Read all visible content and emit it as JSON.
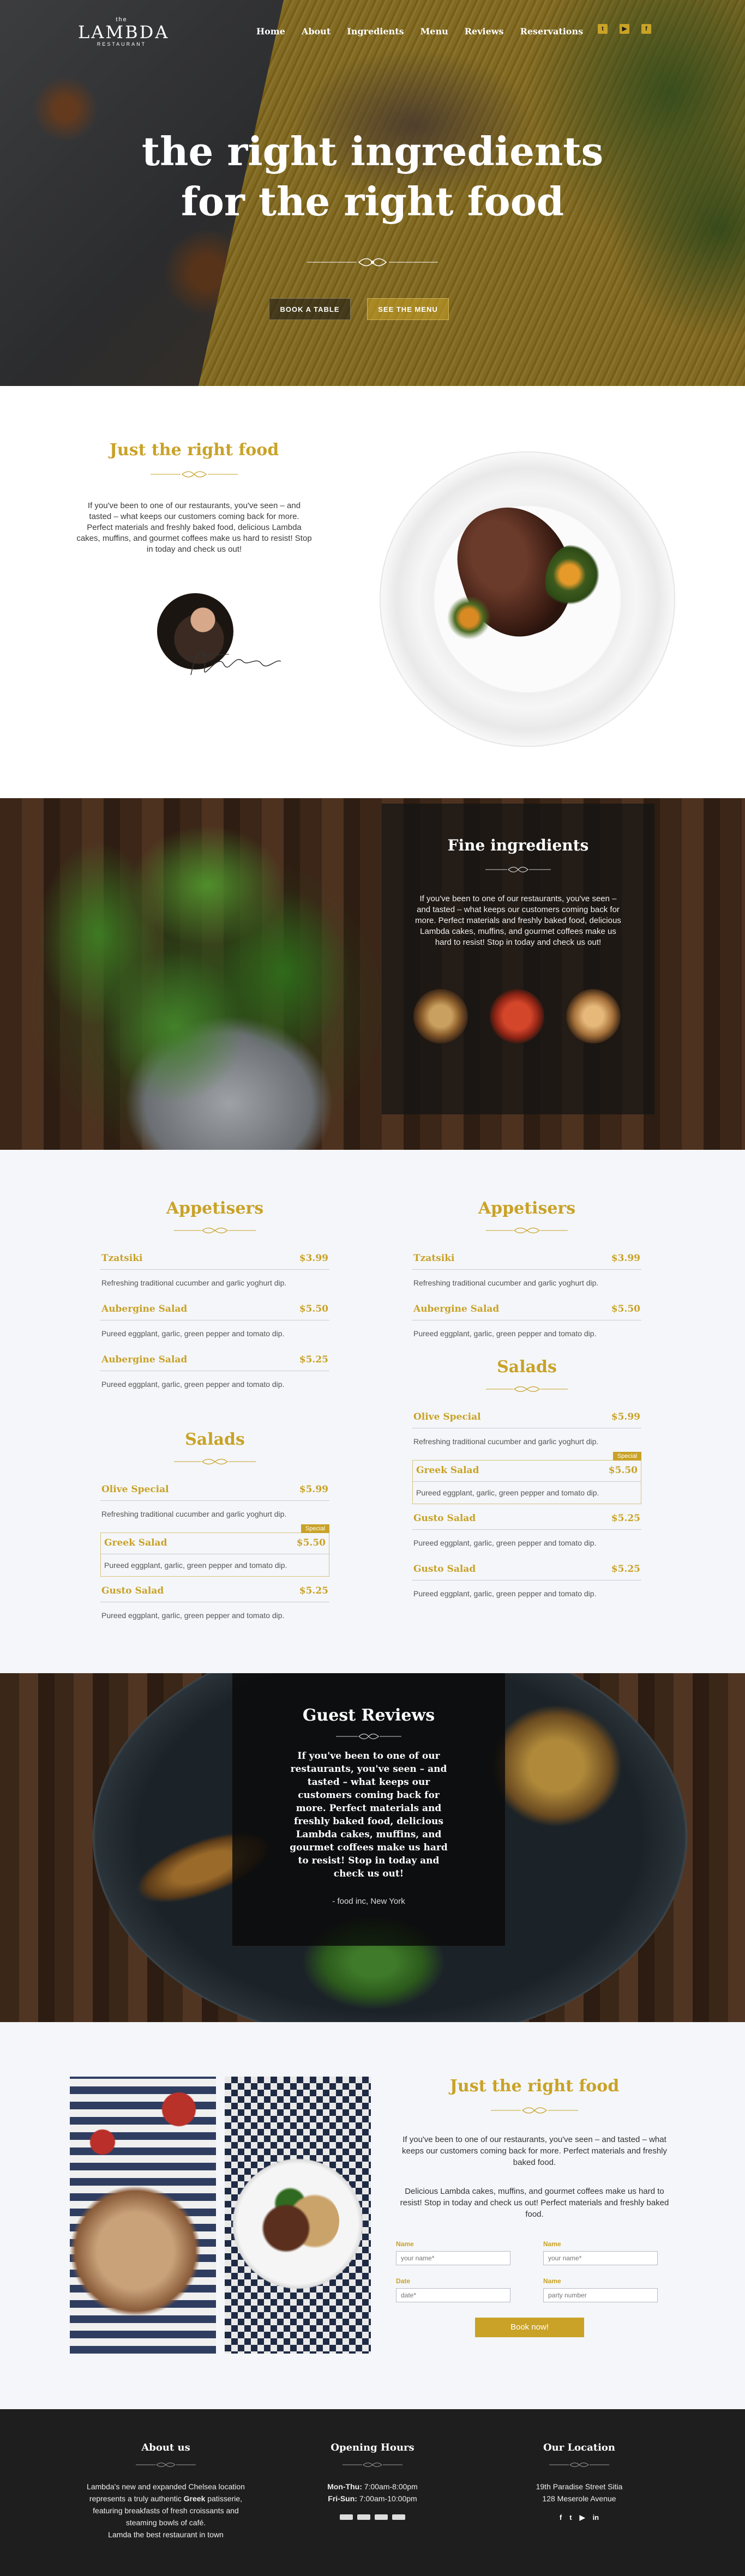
{
  "header": {
    "logo_small": "the",
    "logo_name": "LAMBDA",
    "logo_sub": "RESTAURANT",
    "nav": [
      "Home",
      "About",
      "Ingredients",
      "Menu",
      "Reviews",
      "Reservations"
    ],
    "social_icons": [
      "twitter-icon",
      "youtube-icon",
      "facebook-icon"
    ]
  },
  "hero": {
    "title_line1": "the right ingredients",
    "title_line2": "for the right food",
    "btn_book": "BOOK A TABLE",
    "btn_menu": "SEE THE MENU"
  },
  "about": {
    "title": "Just the right food",
    "text": "If you've been to one of our restaurants, you've seen – and tasted – what keeps our customers coming back for more. Perfect materials and freshly baked food, delicious Lambda cakes, muffins, and gourmet coffees make us hard to resist! Stop in today and check us out!"
  },
  "ingredients": {
    "title": "Fine ingredients",
    "text": "If you've been to one of our restaurants, you've seen – and tasted – what keeps our customers coming back for more. Perfect materials and freshly baked food, delicious Lambda cakes, muffins, and gourmet coffees make us hard to resist! Stop in today and check us out!"
  },
  "menu": {
    "left": {
      "appetisers_title": "Appetisers",
      "appetisers": [
        {
          "name": "Tzatsiki",
          "price": "$3.99",
          "desc": "Refreshing traditional cucumber and garlic yoghurt dip."
        },
        {
          "name": "Aubergine Salad",
          "price": "$5.50",
          "desc": "Pureed eggplant, garlic, green pepper and tomato dip."
        },
        {
          "name": "Aubergine Salad",
          "price": "$5.25",
          "desc": "Pureed eggplant, garlic, green pepper and tomato dip."
        }
      ],
      "salads_title": "Salads",
      "salads": [
        {
          "name": "Olive Special",
          "price": "$5.99",
          "desc": "Refreshing traditional cucumber and garlic yoghurt dip."
        },
        {
          "name": "Greek Salad",
          "price": "$5.50",
          "desc": "Pureed eggplant, garlic, green pepper and tomato dip.",
          "tag": "Special"
        },
        {
          "name": "Gusto Salad",
          "price": "$5.25",
          "desc": "Pureed eggplant, garlic, green pepper and tomato dip."
        }
      ]
    },
    "right": {
      "appetisers_title": "Appetisers",
      "appetisers": [
        {
          "name": "Tzatsiki",
          "price": "$3.99",
          "desc": "Refreshing traditional cucumber and garlic yoghurt dip."
        },
        {
          "name": "Aubergine Salad",
          "price": "$5.50",
          "desc": "Pureed eggplant, garlic, green pepper and tomato dip."
        }
      ],
      "salads_title": "Salads",
      "salads": [
        {
          "name": "Olive Special",
          "price": "$5.99",
          "desc": "Refreshing traditional cucumber and garlic yoghurt dip."
        },
        {
          "name": "Greek Salad",
          "price": "$5.50",
          "desc": "Pureed eggplant, garlic, green pepper and tomato dip.",
          "tag": "Special"
        },
        {
          "name": "Gusto Salad",
          "price": "$5.25",
          "desc": "Pureed eggplant, garlic, green pepper and tomato dip."
        },
        {
          "name": "Gusto Salad",
          "price": "$5.25",
          "desc": "Pureed eggplant, garlic, green pepper and tomato dip."
        }
      ]
    }
  },
  "reviews": {
    "title": "Guest Reviews",
    "quote": "If you've been to one of our restaurants, you've seen – and tasted – what keeps our customers coming back for more. Perfect materials and freshly baked food, delicious Lambda cakes, muffins, and gourmet coffees make us hard to resist! Stop in today and check us out!",
    "author": "- food inc, New York"
  },
  "reservation": {
    "title": "Just the right food",
    "text1": "If you've been to one of our restaurants, you've seen – and tasted – what keeps our customers coming back for more. Perfect materials and freshly baked food.",
    "text2": "Delicious Lambda cakes, muffins, and gourmet coffees make us hard to resist! Stop in today and check us out! Perfect materials and freshly baked food.",
    "fields": {
      "name_label": "Name",
      "name_placeholder": "your name*",
      "name2_label": "Name",
      "name2_placeholder": "your name*",
      "date_label": "Date",
      "date_placeholder": "date*",
      "party_label": "Name",
      "party_placeholder": "party number"
    },
    "submit": "Book now!"
  },
  "footer": {
    "about_title": "About us",
    "about_text_a": "Lambda's new and expanded Chelsea location represents a truly authentic ",
    "about_text_b": "Greek",
    "about_text_c": " patisserie, featuring breakfasts of fresh croissants and steaming bowls of café.",
    "about_text_d": "Lamda the best restaurant in town",
    "hours_title": "Opening Hours",
    "hours_1_label": "Mon-Thu:",
    "hours_1_value": " 7:00am-8:00pm",
    "hours_2_label": "Fri-Sun:",
    "hours_2_value": " 7:00am-10:00pm",
    "location_title": "Our Location",
    "location_1": "19th Paradise Street Sitia",
    "location_2": "128 Meserole Avenue",
    "icons": [
      "facebook-icon",
      "twitter-icon",
      "youtube-icon",
      "linkedin-icon"
    ]
  },
  "colors": {
    "accent": "#c9a227",
    "dark": "#1e1e1e",
    "light_bg": "#f4f6f9"
  }
}
